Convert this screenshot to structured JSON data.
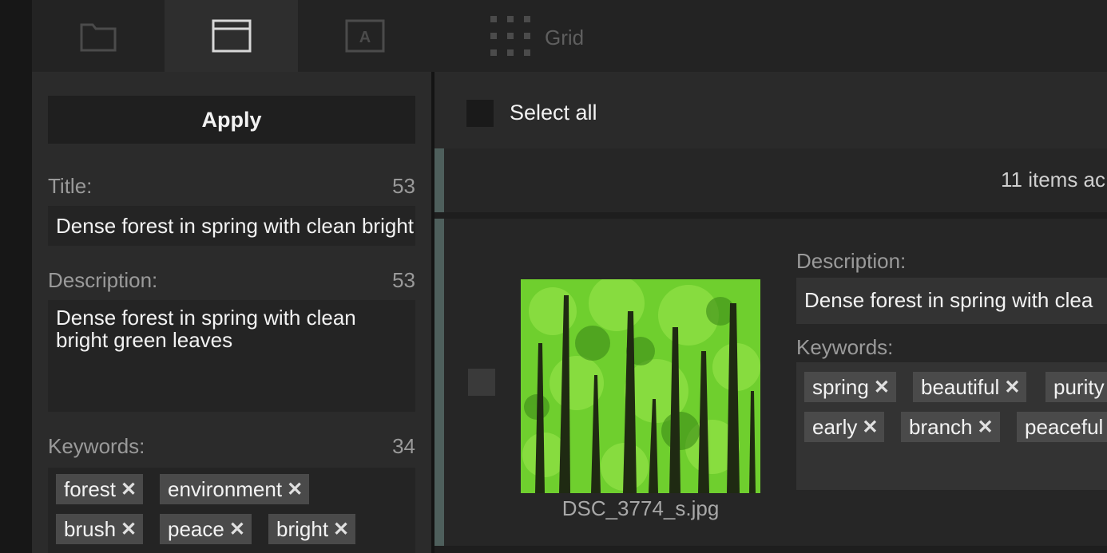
{
  "tabs": {
    "items": [
      {
        "name": "folder",
        "icon": "folder-icon",
        "active": false
      },
      {
        "name": "editor",
        "icon": "window-icon",
        "active": true
      },
      {
        "name": "text",
        "icon": "text-a-icon",
        "active": false
      }
    ],
    "grid_label": "Grid",
    "grid_icon": "grid-dots-icon"
  },
  "panel": {
    "apply_label": "Apply",
    "title_label": "Title:",
    "title_count": "53",
    "title_value": "Dense forest in spring with clean bright green leaves",
    "description_label": "Description:",
    "description_count": "53",
    "description_value": "Dense forest in spring with clean bright green leaves",
    "keywords_label": "Keywords:",
    "keywords_count": "34",
    "keywords": [
      "forest",
      "environment",
      "brush",
      "peace",
      "bright"
    ]
  },
  "main": {
    "select_all_label": "Select all",
    "info_text": "11 items ac",
    "card": {
      "filename": "DSC_3774_s.jpg",
      "description_label": "Description:",
      "description_value": "Dense forest in spring with clea",
      "keywords_label": "Keywords:",
      "keywords": [
        "spring",
        "beautiful",
        "purity",
        "early",
        "branch",
        "peaceful"
      ]
    }
  },
  "colors": {
    "accent_strip": "#4e5f5c",
    "tag_bg": "#4a4a4a",
    "panel_bg": "#2b2b2b"
  }
}
